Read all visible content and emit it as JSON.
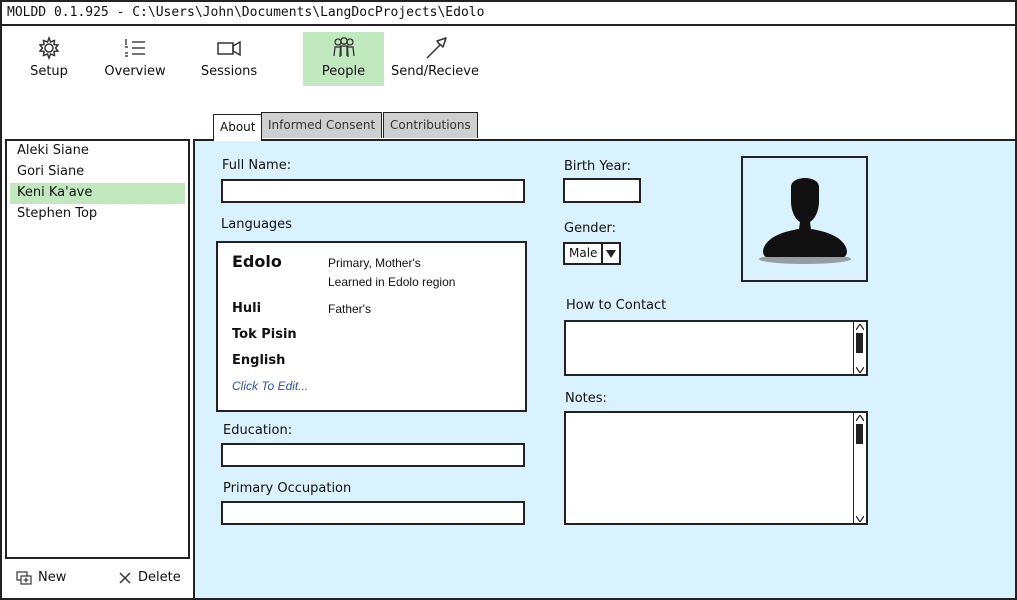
{
  "window": {
    "title": "MOLDD 0.1.925  - C:\\Users\\John\\Documents\\LangDocProjects\\Edolo"
  },
  "toolbar": {
    "items": [
      {
        "label": "Setup",
        "icon": "gear-icon"
      },
      {
        "label": "Overview",
        "icon": "list-icon"
      },
      {
        "label": "Sessions",
        "icon": "video-camera-icon"
      },
      {
        "label": "People",
        "icon": "people-icon",
        "active": true
      },
      {
        "label": "Send/Recieve",
        "icon": "send-arrow-icon"
      }
    ]
  },
  "tabs": [
    {
      "label": "About",
      "active": true
    },
    {
      "label": "Informed Consent",
      "active": false
    },
    {
      "label": "Contributions",
      "active": false
    }
  ],
  "people": {
    "items": [
      "Aleki Siane",
      "Gori Siane",
      "Keni Ka'ave",
      "Stephen Top"
    ],
    "selected": "Keni Ka'ave",
    "new_label": "New",
    "delete_label": "Delete"
  },
  "form": {
    "full_name_label": "Full Name:",
    "full_name_value": "",
    "languages_label": "Languages",
    "languages": [
      {
        "name": "Edolo",
        "note_line1": "Primary, Mother's",
        "note_line2": "Learned in Edolo region"
      },
      {
        "name": "Huli",
        "note_line1": "Father's"
      },
      {
        "name": "Tok Pisin"
      },
      {
        "name": "English"
      }
    ],
    "languages_edit": "Click To Edit...",
    "education_label": "Education:",
    "education_value": "",
    "occupation_label": "Primary Occupation",
    "occupation_value": "",
    "birth_year_label": "Birth Year:",
    "birth_year_value": "",
    "gender_label": "Gender:",
    "gender_value": "Male",
    "contact_label": "How to Contact",
    "notes_label": "Notes:"
  },
  "colors": {
    "panel_bg": "#d9f2fd",
    "selection_green": "#c2e8c0",
    "link_blue": "#2a55a0",
    "inactive_tab": "#cfcfcf"
  }
}
